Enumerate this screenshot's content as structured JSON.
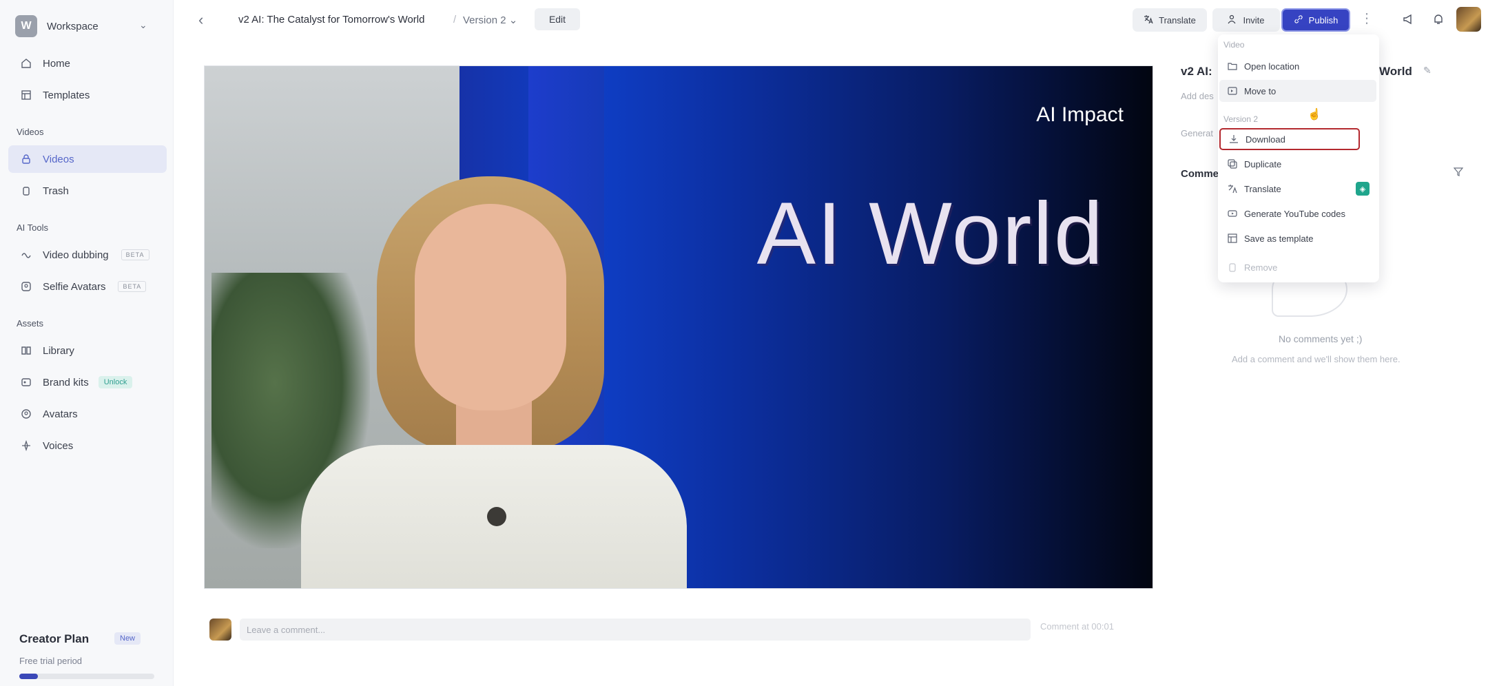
{
  "sidebar": {
    "workspace": {
      "logo_letter": "W",
      "name": "Workspace"
    },
    "items": [
      {
        "label": "Home",
        "icon": "home-icon"
      },
      {
        "label": "Templates",
        "icon": "templates-icon"
      }
    ],
    "videos_section": {
      "title": "Videos",
      "items": [
        {
          "label": "Videos",
          "icon": "lock-icon",
          "active": true
        },
        {
          "label": "Trash",
          "icon": "trash-icon"
        }
      ]
    },
    "ai_tools_section": {
      "title": "AI Tools",
      "items": [
        {
          "label": "Video dubbing",
          "icon": "dubbing-icon",
          "badge": "BETA"
        },
        {
          "label": "Selfie Avatars",
          "icon": "selfie-avatar-icon",
          "badge": "BETA"
        }
      ]
    },
    "assets_section": {
      "title": "Assets",
      "items": [
        {
          "label": "Library",
          "icon": "library-icon"
        },
        {
          "label": "Brand kits",
          "icon": "brand-kits-icon",
          "badge": "Unlock"
        },
        {
          "label": "Avatars",
          "icon": "avatars-icon"
        },
        {
          "label": "Voices",
          "icon": "voices-icon"
        }
      ]
    },
    "plan": {
      "title": "Creator Plan",
      "subtitle": "Free trial period",
      "upgrade": "New",
      "progress": 0.14
    }
  },
  "header": {
    "title": "v2 AI: The Catalyst for Tomorrow's World",
    "separator": "/",
    "version": "Version 2",
    "edit_label": "Edit",
    "translate_label": "Translate",
    "invite_label": "Invite",
    "publish_label": "Publish"
  },
  "video": {
    "tagline": "AI Impact",
    "headline": "AI World"
  },
  "comment_bar": {
    "placeholder": "Leave a comment...",
    "send_label": "Comment at 00:01"
  },
  "right_panel": {
    "title_start": "v2 AI:",
    "title_end": "World",
    "description_placeholder": "Add des",
    "generated_label": "Generat",
    "comments_title": "Comme",
    "empty_title": "No comments yet ;)",
    "empty_subtitle": "Add a comment and we'll show them here."
  },
  "menu": {
    "video_section": "Video",
    "version_section": "Version 2",
    "items": {
      "open_location": "Open location",
      "move_to": "Move to",
      "download": "Download",
      "duplicate": "Duplicate",
      "translate": "Translate",
      "youtube": "Generate YouTube codes",
      "save_template": "Save as template",
      "remove": "Remove"
    }
  },
  "colors": {
    "accent": "#3643c2",
    "active_nav": "#5566c9",
    "selected_outline": "#b3282e"
  }
}
